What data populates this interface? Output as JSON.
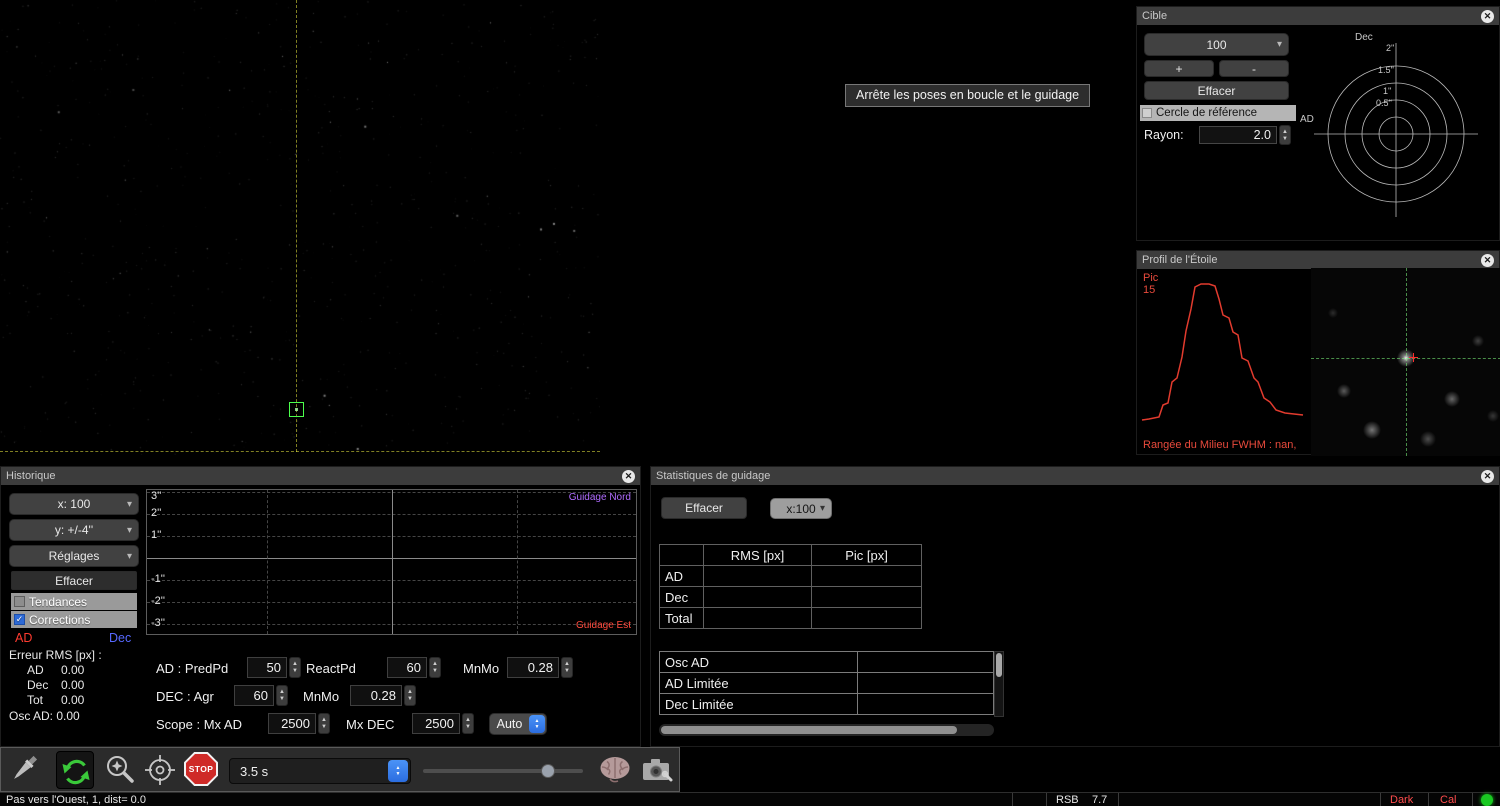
{
  "icons": {
    "close": "✕",
    "chevron_down": "▾",
    "arrow_up": "▲",
    "arrow_down": "▼",
    "check": "✓"
  },
  "tooltip": {
    "text": "Arrête les poses en boucle et le guidage"
  },
  "cible": {
    "title": "Cible",
    "zoom": "100",
    "plus": "+",
    "minus": "-",
    "effacer": "Effacer",
    "ref_circle": "Cercle de référence",
    "rayon_label": "Rayon:",
    "rayon_value": "2.0",
    "axis_dec": "Dec",
    "axis_ad": "AD",
    "rings": [
      "2''",
      "1.5''",
      "1''",
      "0.5''"
    ]
  },
  "profil": {
    "title": "Profil de l'Étoile",
    "pic_label": "Pic",
    "pic_value": "15",
    "fwhm": "Rangée du Milieu FWHM : nan,"
  },
  "historique": {
    "title": "Historique",
    "dd_x": "x: 100",
    "dd_y": "y: +/-4''",
    "dd_reglages": "Réglages",
    "effacer": "Effacer",
    "tendances": "Tendances",
    "corrections": "Corrections",
    "legend_ad": "AD",
    "legend_dec": "Dec",
    "rms_title": "Erreur RMS [px] :",
    "rms": [
      {
        "label": "AD",
        "value": "0.00"
      },
      {
        "label": "Dec",
        "value": "0.00"
      },
      {
        "label": "Tot",
        "value": "0.00"
      }
    ],
    "osc": "Osc AD: 0.00",
    "graph": {
      "y_labels": [
        "3''",
        "2''",
        "1''",
        "-1''",
        "-2''",
        "-3''"
      ],
      "legend_north": "Guidage Nord",
      "legend_east": "Guidage Est"
    },
    "params": {
      "row1_label": "AD : PredPd",
      "predpd": "50",
      "reactpd_label": "ReactPd",
      "reactpd": "60",
      "mnmo1_label": "MnMo",
      "mnmo1": "0.28",
      "row2_label": "DEC : Agr",
      "agr": "60",
      "mnmo2_label": "MnMo",
      "mnmo2": "0.28",
      "row3_label": "Scope : Mx AD",
      "mx_ad": "2500",
      "mx_dec_label": "Mx DEC",
      "mx_dec": "2500",
      "auto": "Auto"
    }
  },
  "stats": {
    "title": "Statistiques de guidage",
    "effacer": "Effacer",
    "scale": "x:100",
    "col_rms": "RMS [px]",
    "col_pic": "Pic [px]",
    "rows": [
      "AD",
      "Dec",
      "Total"
    ],
    "rows2": [
      "Osc AD",
      "AD Limitée",
      "Dec Limitée"
    ]
  },
  "toolbar": {
    "exposure": "3.5 s",
    "stop": "STOP"
  },
  "statusbar": {
    "message": "Pas vers l'Ouest, 1, dist= 0.0",
    "rsb_label": "RSB",
    "rsb_value": "7.7",
    "dark": "Dark",
    "cal": "Cal"
  }
}
